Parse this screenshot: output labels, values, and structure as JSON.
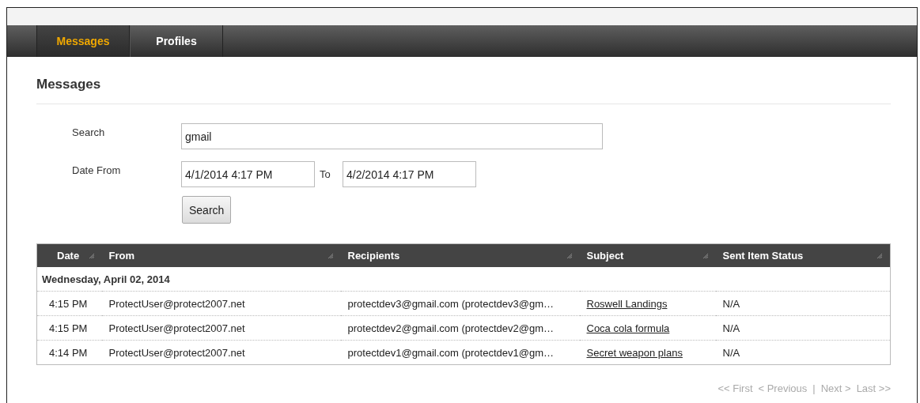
{
  "nav_tabs": [
    {
      "label": "Messages",
      "selected": true
    },
    {
      "label": "Profiles",
      "selected": false
    }
  ],
  "heading": "Messages",
  "search_form": {
    "search_label": "Search",
    "search_value": "gmail",
    "date_from_label": "Date From",
    "date_from_value": "4/1/2014 4:17 PM",
    "to_label": "To",
    "date_to_value": "4/2/2014 4:17 PM",
    "search_button": "Search"
  },
  "table": {
    "columns": [
      "Date",
      "From",
      "Recipients",
      "Subject",
      "Sent Item Status"
    ],
    "groups": [
      {
        "label": "Wednesday, April 02, 2014",
        "rows": [
          {
            "date": "4:15 PM",
            "from": "ProtectUser@protect2007.net",
            "recipients": "protectdev3@gmail.com (protectdev3@gm…",
            "subject": "Roswell Landings",
            "status": "N/A"
          },
          {
            "date": "4:15 PM",
            "from": "ProtectUser@protect2007.net",
            "recipients": "protectdev2@gmail.com (protectdev2@gm…",
            "subject": "Coca cola formula",
            "status": "N/A"
          },
          {
            "date": "4:14 PM",
            "from": "ProtectUser@protect2007.net",
            "recipients": "protectdev1@gmail.com (protectdev1@gm…",
            "subject": "Secret weapon plans",
            "status": "N/A"
          }
        ]
      }
    ]
  },
  "pagination": [
    {
      "kind": "link",
      "label": "<< First",
      "disabled": true
    },
    {
      "kind": "link",
      "label": "< Previous",
      "disabled": true
    },
    {
      "kind": "separator",
      "label": "|"
    },
    {
      "kind": "link",
      "label": "Next >",
      "disabled": true
    },
    {
      "kind": "link",
      "label": "Last >>",
      "disabled": true
    }
  ]
}
